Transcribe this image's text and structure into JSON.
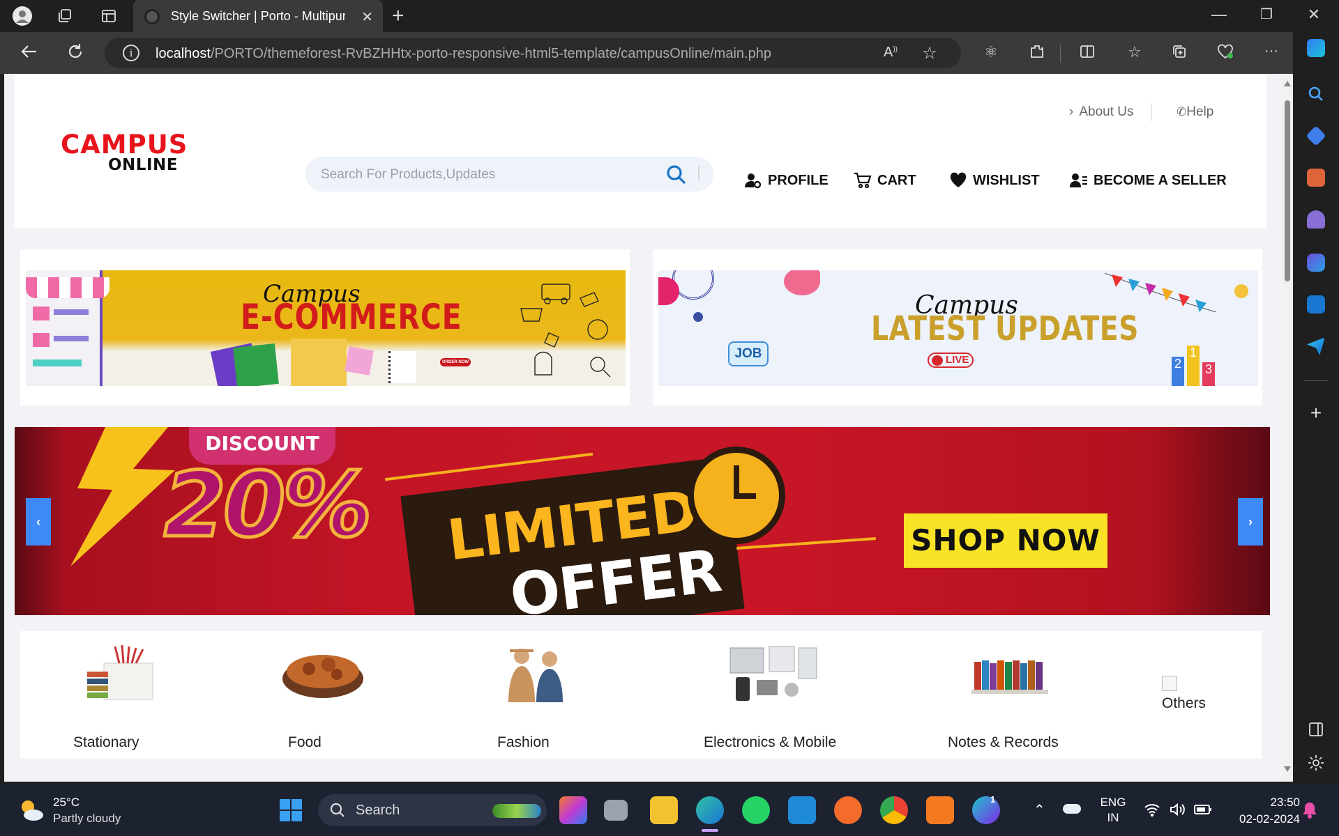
{
  "browser": {
    "tab_title": "Style Switcher | Porto - Multipurp",
    "url_host": "localhost",
    "url_path": "/PORTO/themeforest-RvBZHHtx-porto-responsive-html5-template/campusOnline/main.php"
  },
  "site": {
    "logo_top": "CAMPUS",
    "logo_bottom": "ONLINE",
    "top_links": {
      "about": "About Us",
      "help": "Help"
    },
    "search": {
      "placeholder": "Search For Products,Updates",
      "value": ""
    },
    "nav": {
      "profile": "PROFILE",
      "cart": "CART",
      "wishlist": "WISHLIST",
      "seller": "BECOME A SELLER"
    },
    "banners": {
      "ecommerce": {
        "script": "Campus",
        "title": "E-COMMERCE",
        "tag": "ORDER NOW"
      },
      "updates": {
        "script": "Campus",
        "title": "LATEST UPDATES",
        "live": "LIVE",
        "job": "JOB",
        "podium": [
          "2",
          "1",
          "3"
        ]
      }
    },
    "offer": {
      "discount_label": "DISCOUNT",
      "discount_value": "20%",
      "line1": "LIMITED",
      "line2": "OFFER",
      "cta": "SHOP NOW",
      "prev": "‹",
      "next": "›"
    },
    "categories": [
      {
        "label": "Stationary"
      },
      {
        "label": "Food"
      },
      {
        "label": "Fashion"
      },
      {
        "label": "Electronics & Mobile"
      },
      {
        "label": "Notes & Records"
      },
      {
        "label": "Others"
      }
    ]
  },
  "taskbar": {
    "weather_temp": "25°C",
    "weather_cond": "Partly cloudy",
    "search_label": "Search",
    "lang_line1": "ENG",
    "lang_line2": "IN",
    "time": "23:50",
    "date": "02-02-2024",
    "canva_badge": "1"
  },
  "colors": {
    "brand_red": "#e8141b",
    "nav_text": "#111111",
    "accent_blue": "#3d8af7",
    "shop_yellow": "#f8e326"
  }
}
